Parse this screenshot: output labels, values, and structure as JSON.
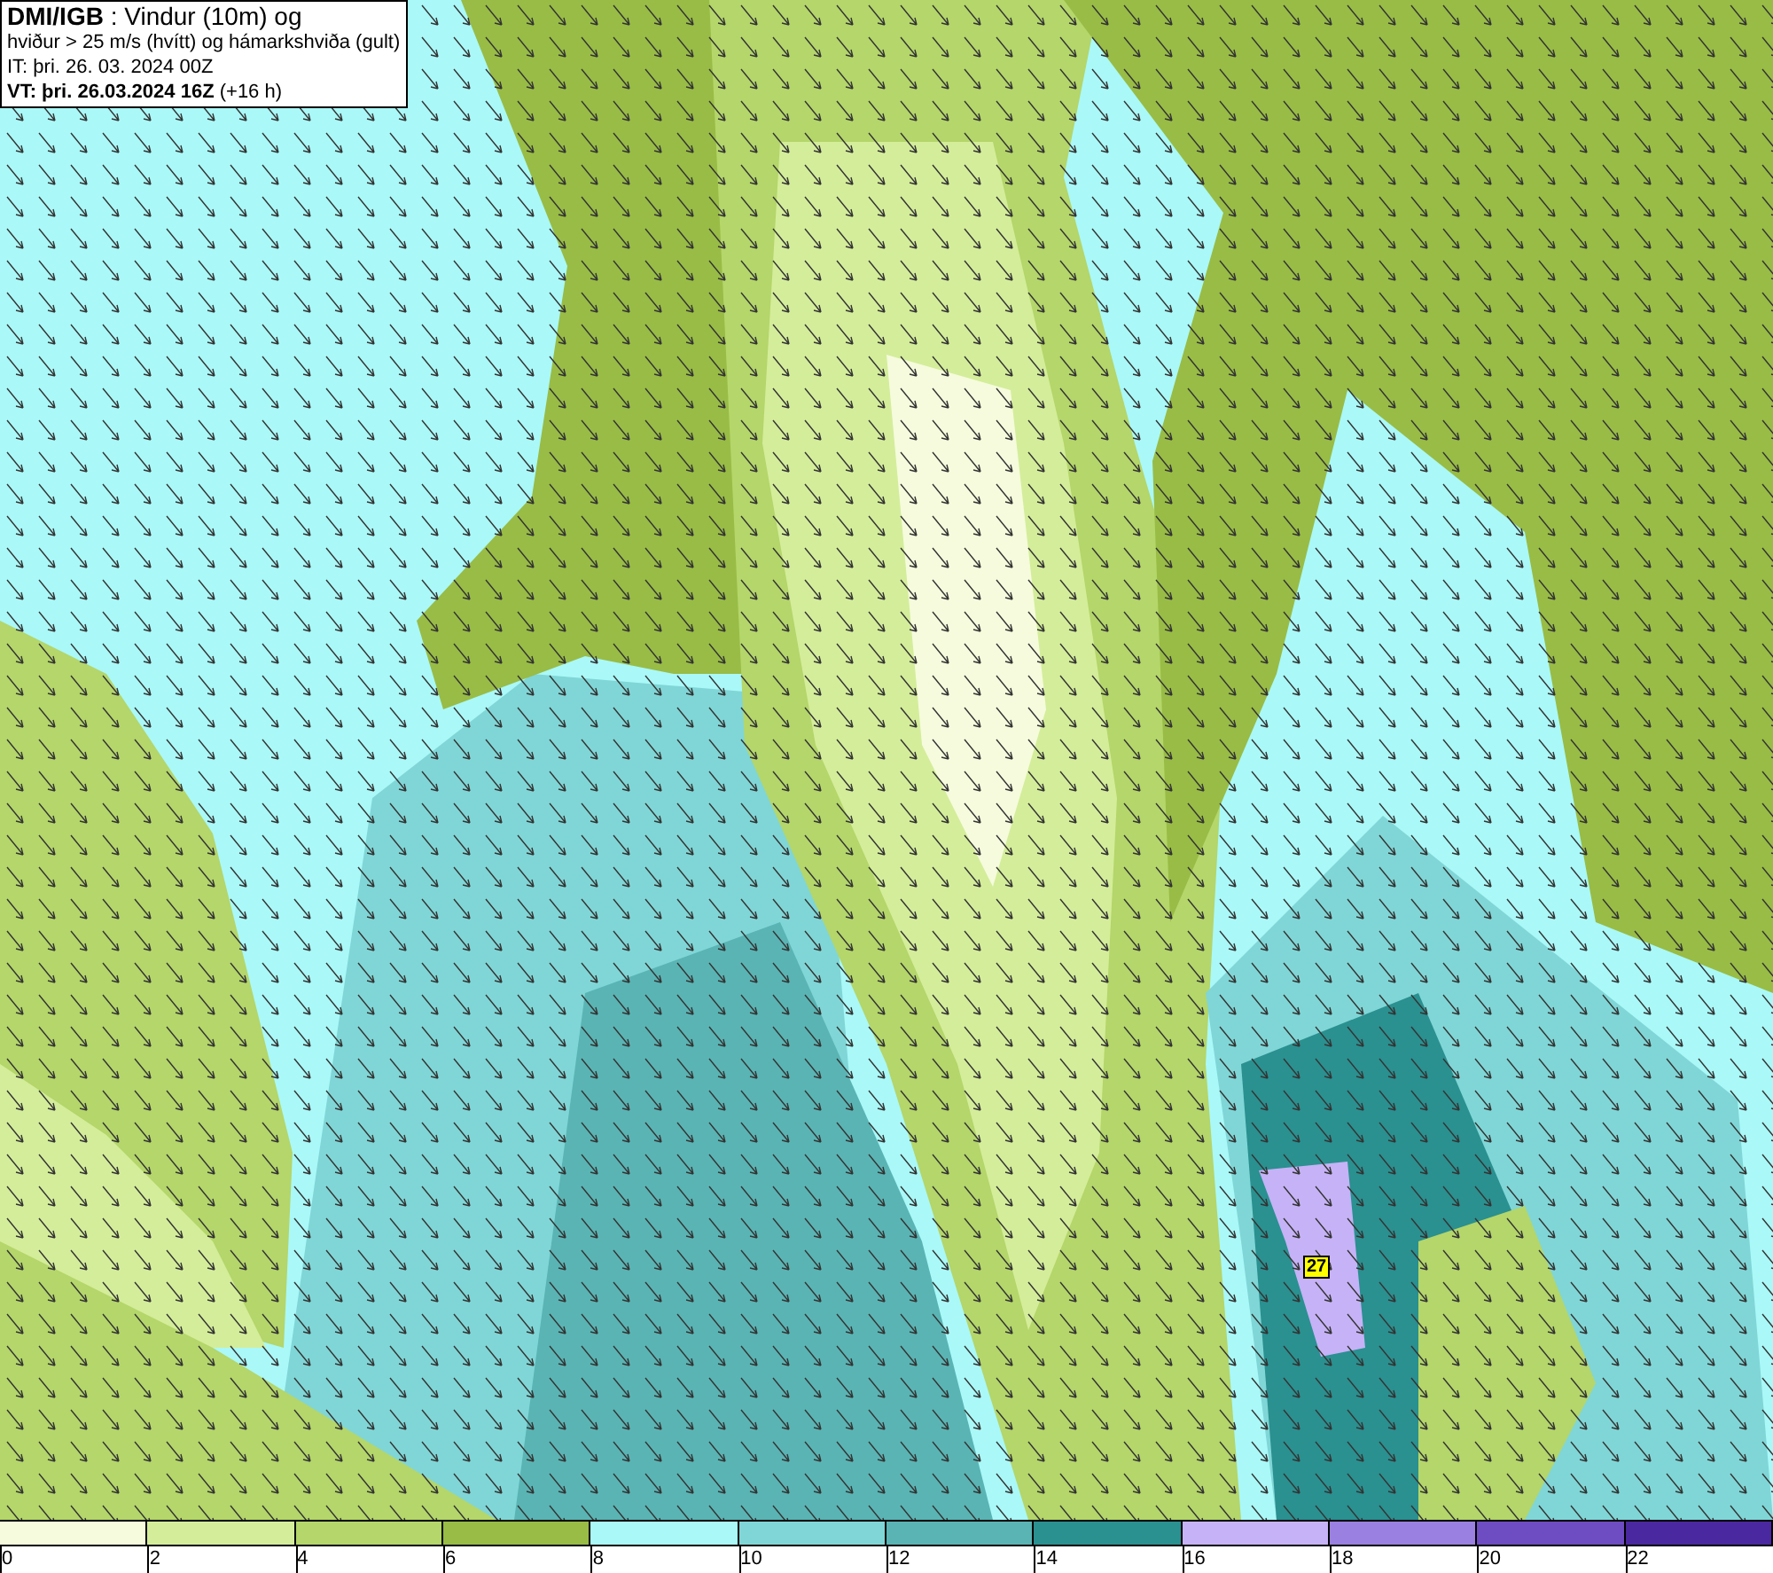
{
  "header": {
    "lines": [
      "**DMI/IGB** : Vindur (10m) og",
      "hviður > 25 m/s (hvítt) og hámarkshviða (gult)",
      "IT: þri. 26. 03. 2024 00Z",
      "**VT: þri. 26.03.2024 16Z** (+16 h)"
    ]
  },
  "map": {
    "gust_label": "27"
  },
  "legend": {
    "bins": [
      {
        "label": "0",
        "color": "#f5fbdc"
      },
      {
        "label": "2",
        "color": "#d4ed9a"
      },
      {
        "label": "4",
        "color": "#b4d66a"
      },
      {
        "label": "6",
        "color": "#98bc45"
      },
      {
        "label": "8",
        "color": "#aaf8f8"
      },
      {
        "label": "10",
        "color": "#80d6d6"
      },
      {
        "label": "12",
        "color": "#5ab4b4"
      },
      {
        "label": "14",
        "color": "#2a9090"
      },
      {
        "label": "16",
        "color": "#c6b2f6"
      },
      {
        "label": "18",
        "color": "#9a80e0"
      },
      {
        "label": "20",
        "color": "#6e4cc2"
      },
      {
        "label": "22",
        "color": "#4a28a0"
      }
    ]
  }
}
